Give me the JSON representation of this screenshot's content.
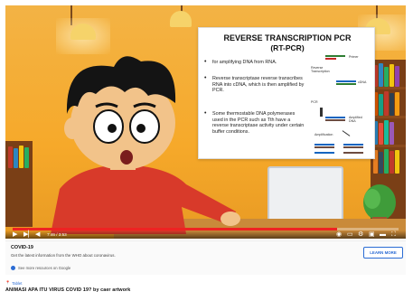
{
  "slide": {
    "title": "REVERSE TRANSCRIPTION PCR",
    "subtitle": "(RT-PCR)",
    "bullets": [
      "for amplifying DNA from RNA.",
      "Reverse transcriptase reverse transcribes RNA into cDNA, which is then amplified by PCR.",
      "Some thermostable DNA polymerases used in the PCR such as Tth have a reverse transcriptase activity under certain buffer conditions."
    ],
    "diagram_labels": {
      "reverse_transcription": "Reverse Transcription",
      "cdna": "cDNA",
      "pcr": "PCR",
      "amplified_dna": "Amplified DNA",
      "amplification": "Amplification",
      "primer": "Primer"
    }
  },
  "player": {
    "time": "7:46 / 3:53",
    "progress": 0.84,
    "accent": "#ee2222"
  },
  "info_card": {
    "title": "COVID-19",
    "description": "Get the latest information from the WHO about coronavirus.",
    "learn_more": "LEARN MORE",
    "resources": "See more resources on Google"
  },
  "location": "Tablet",
  "video_title": "ANIMASI APA ITU VIRUS COVID 19? by caer artwork"
}
